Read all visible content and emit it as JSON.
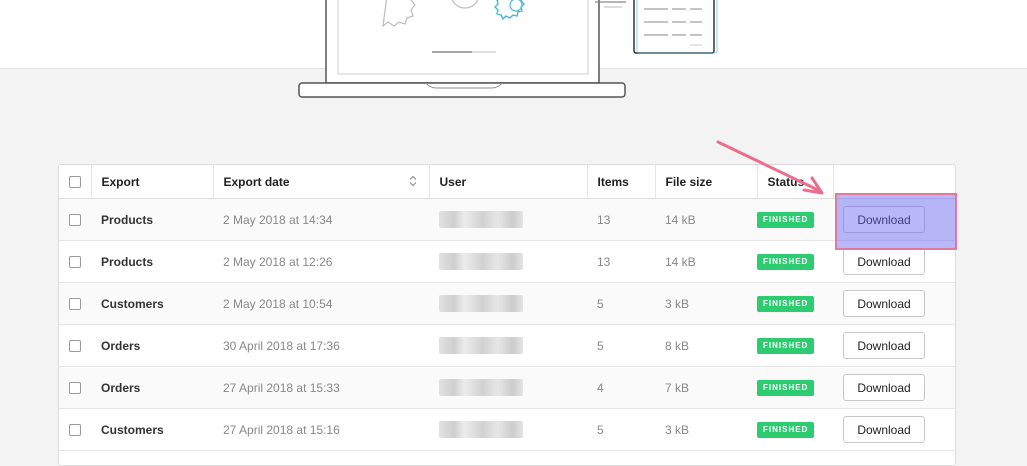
{
  "table": {
    "headers": {
      "export": "Export",
      "export_date": "Export date",
      "user": "User",
      "items": "Items",
      "file_size": "File size",
      "status": "Status"
    },
    "rows": [
      {
        "export": "Products",
        "date": "2 May 2018 at 14:34",
        "items": "13",
        "size": "14 kB",
        "status": "FINISHED",
        "action": "Download"
      },
      {
        "export": "Products",
        "date": "2 May 2018 at 12:26",
        "items": "13",
        "size": "14 kB",
        "status": "FINISHED",
        "action": "Download"
      },
      {
        "export": "Customers",
        "date": "2 May 2018 at 10:54",
        "items": "5",
        "size": "3 kB",
        "status": "FINISHED",
        "action": "Download"
      },
      {
        "export": "Orders",
        "date": "30 April 2018 at 17:36",
        "items": "5",
        "size": "8 kB",
        "status": "FINISHED",
        "action": "Download"
      },
      {
        "export": "Orders",
        "date": "27 April 2018 at 15:33",
        "items": "4",
        "size": "7 kB",
        "status": "FINISHED",
        "action": "Download"
      },
      {
        "export": "Customers",
        "date": "27 April 2018 at 15:16",
        "items": "5",
        "size": "3 kB",
        "status": "FINISHED",
        "action": "Download"
      }
    ]
  },
  "colors": {
    "status_finished": "#2ecc71",
    "highlight_fill": "#5f5ff5",
    "annotation_red": "#eb6e8c",
    "illustration_teal": "#47b8d6"
  },
  "icons": {
    "sort": "sort-updown-icon",
    "illustration": "laptop-gears-illustration",
    "annotation": "arrow-annotation"
  }
}
